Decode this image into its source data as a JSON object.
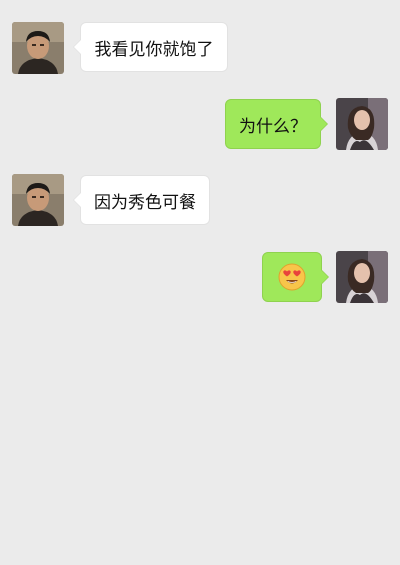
{
  "messages": [
    {
      "direction": "in",
      "type": "text",
      "text": "我看见你就饱了",
      "avatar": "male-contact-avatar"
    },
    {
      "direction": "out",
      "type": "text",
      "text": "为什么？",
      "avatar": "female-self-avatar"
    },
    {
      "direction": "in",
      "type": "text",
      "text": "因为秀色可餐",
      "avatar": "male-contact-avatar"
    },
    {
      "direction": "out",
      "type": "emoji",
      "emoji": "smiling-face-with-heart-eyes-icon",
      "avatar": "female-self-avatar"
    }
  ],
  "colors": {
    "background": "#ebebeb",
    "incoming_bubble": "#ffffff",
    "outgoing_bubble": "#9fe85a"
  }
}
